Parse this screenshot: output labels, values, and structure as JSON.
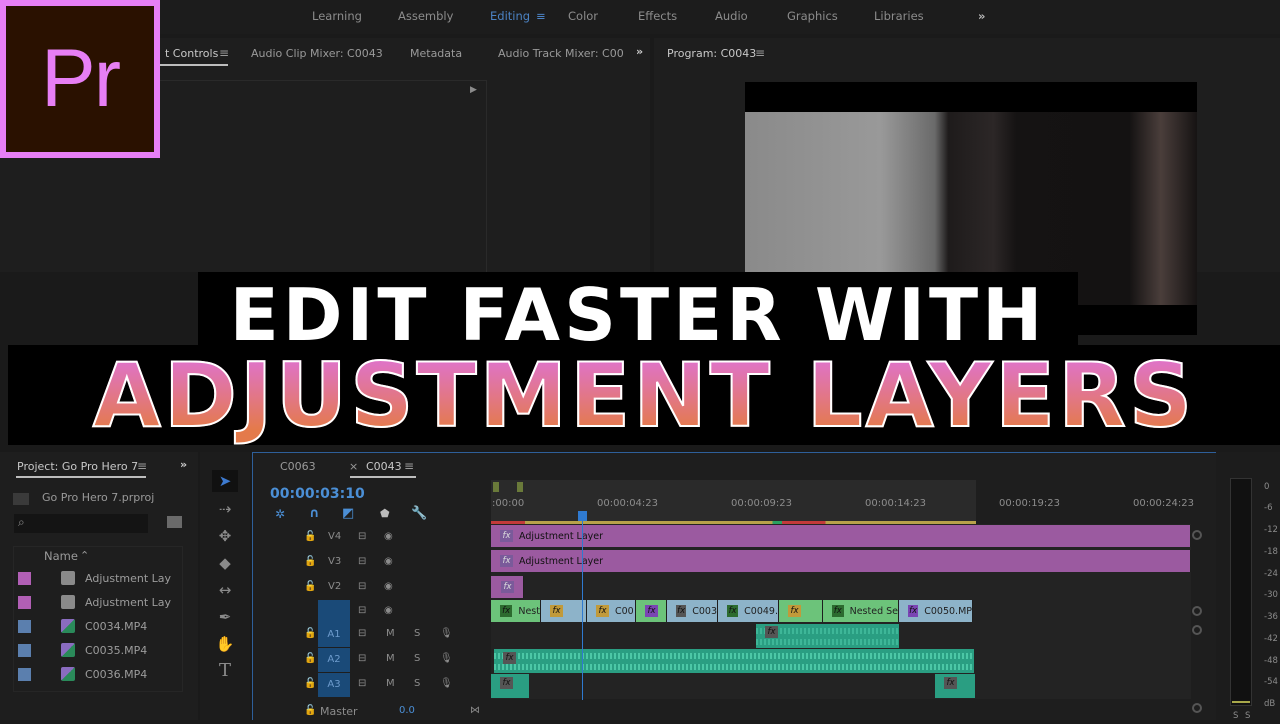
{
  "workspaces": {
    "tabs": [
      "Learning",
      "Assembly",
      "Editing",
      "Color",
      "Effects",
      "Audio",
      "Graphics",
      "Libraries"
    ],
    "active": "Editing",
    "overflow_icon": "»"
  },
  "logo": {
    "text": "Pr",
    "bg": "#2a1100",
    "accent": "#e77ff5"
  },
  "source_panel": {
    "tabs": [
      "Effect Controls",
      "Audio Clip Mixer: C0043",
      "Metadata",
      "Audio Track Mixer: C00"
    ],
    "visible_active_label": "t Controls",
    "overflow_icon": "»"
  },
  "program": {
    "title": "Program: C0043",
    "menu_icon": "≡"
  },
  "overlay": {
    "line1": "EDIT FASTER WITH",
    "line2": "ADJUSTMENT LAYERS",
    "gradient_top": "#df73c9",
    "gradient_bottom": "#e47a4a"
  },
  "project": {
    "tab": "Project: Go Pro Hero 7",
    "file": "Go Pro Hero 7.prproj",
    "search_placeholder": "",
    "column": "Name",
    "items": [
      {
        "name": "Adjustment Lay",
        "color": "#b15fb5",
        "type": "adjustment"
      },
      {
        "name": "Adjustment Lay",
        "color": "#b15fb5",
        "type": "adjustment"
      },
      {
        "name": "C0034.MP4",
        "color": "#5b7fae",
        "type": "video"
      },
      {
        "name": "C0035.MP4",
        "color": "#5b7fae",
        "type": "video"
      },
      {
        "name": "C0036.MP4",
        "color": "#5b7fae",
        "type": "video"
      }
    ]
  },
  "timeline": {
    "tabs": [
      "C0063",
      "C0043"
    ],
    "active_tab": "C0043",
    "close_icon": "×",
    "timecode": "00:00:03:10",
    "timecode_color": "#4b8fd6",
    "ruler": [
      ":00:00",
      "00:00:04:23",
      "00:00:09:23",
      "00:00:14:23",
      "00:00:19:23",
      "00:00:24:23"
    ],
    "video_tracks": [
      "V4",
      "V3",
      "V2",
      ""
    ],
    "audio_tracks": [
      "A1",
      "A2",
      "A3"
    ],
    "audio_buttons": {
      "mute": "M",
      "solo": "S"
    },
    "master_label": "Master",
    "master_value": "0.0",
    "v4_clips": [
      {
        "label": "Adjustment Layer",
        "fx": "fx"
      }
    ],
    "v3_clips": [
      {
        "label": "Adjustment Layer",
        "fx": "fx"
      }
    ],
    "v2_clips": [
      {
        "label": "",
        "fx": "fx"
      }
    ],
    "v1_clips": [
      {
        "label": "Nest",
        "color": "#6cc37a",
        "fx_color": "#2c6b2f"
      },
      {
        "label": "",
        "color": "#8db3c9",
        "fx_color": "#c19a3a"
      },
      {
        "label": "C00",
        "color": "#8db3c9",
        "fx_color": "#c19a3a"
      },
      {
        "label": "",
        "color": "#6cc37a",
        "fx_color": "#7a45b3"
      },
      {
        "label": "C003",
        "color": "#8db3c9",
        "fx_color": "#555555"
      },
      {
        "label": "C0049.",
        "color": "#8db3c9",
        "fx_color": "#2c6b2f"
      },
      {
        "label": "",
        "color": "#6cc37a",
        "fx_color": "#c19a3a"
      },
      {
        "label": "Nested Se",
        "color": "#6cc37a",
        "fx_color": "#2c6b2f"
      },
      {
        "label": "C0050.MP",
        "color": "#8db3c9",
        "fx_color": "#7a45b3"
      }
    ],
    "adjustment_color": "#9b5aa0"
  },
  "meter": {
    "scale": [
      "0",
      "-6",
      "-12",
      "-18",
      "-24",
      "-30",
      "-36",
      "-42",
      "-48",
      "-54",
      "dB"
    ],
    "solo_labels": [
      "S",
      "S"
    ]
  }
}
